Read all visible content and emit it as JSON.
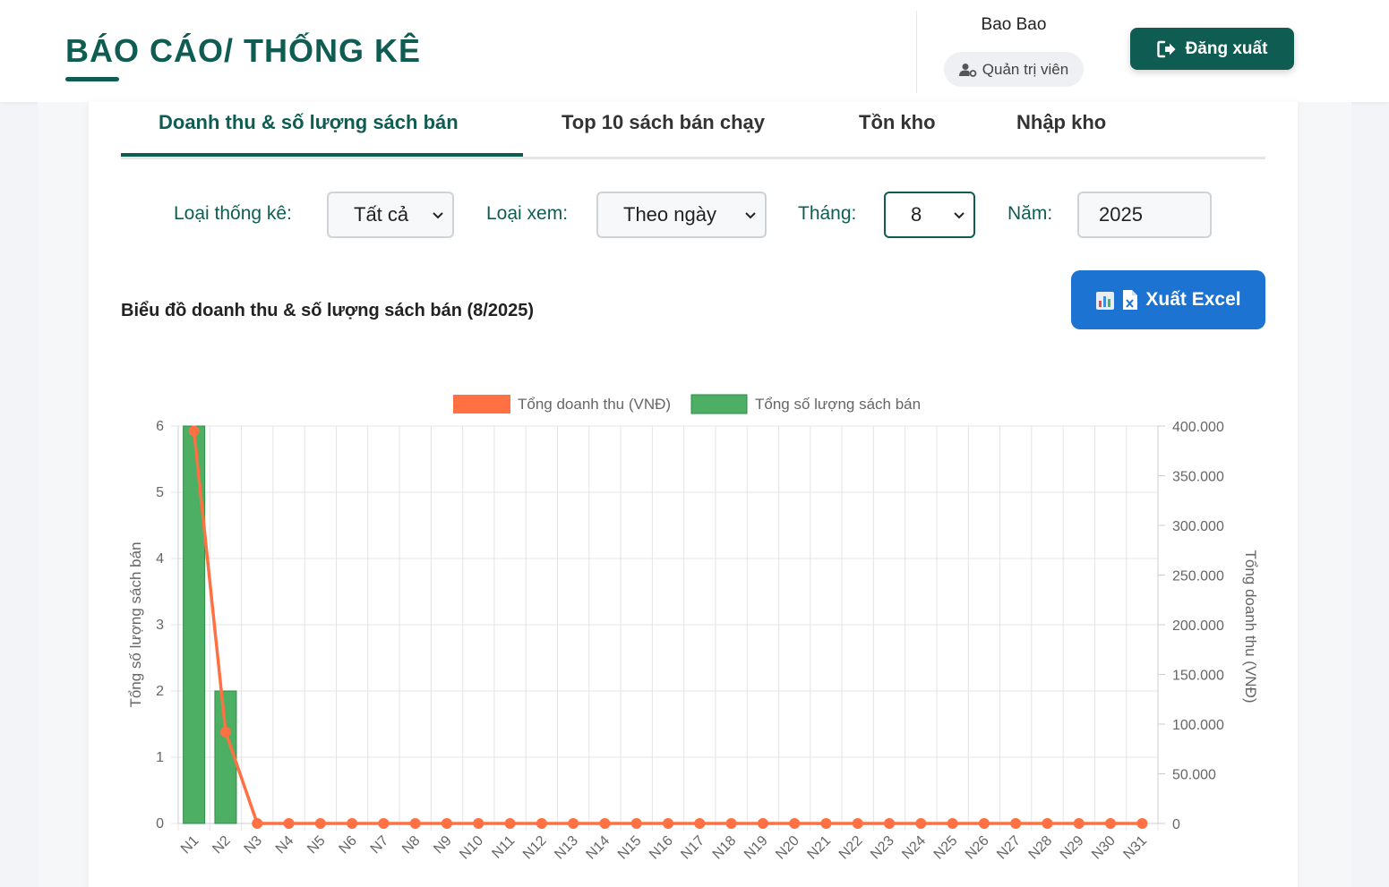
{
  "header": {
    "title": "BÁO CÁO/ THỐNG KÊ",
    "user_name": "Bao Bao",
    "role": "Quản trị viên",
    "logout_label": "Đăng xuất"
  },
  "tabs": [
    {
      "label": "Doanh thu & số lượng sách bán",
      "active": true
    },
    {
      "label": "Top 10 sách bán chạy",
      "active": false
    },
    {
      "label": "Tồn kho",
      "active": false
    },
    {
      "label": "Nhập kho",
      "active": false
    }
  ],
  "filters": {
    "stat_type_label": "Loại thống kê:",
    "stat_type_value": "Tất cả",
    "view_type_label": "Loại xem:",
    "view_type_value": "Theo ngày",
    "month_label": "Tháng:",
    "month_value": "8",
    "year_label": "Năm:",
    "year_value": "2025"
  },
  "chart_section": {
    "heading": "Biểu đồ doanh thu & số lượng sách bán (8/2025)",
    "export_label": "Xuất Excel"
  },
  "colors": {
    "brand": "#0f5d52",
    "revenue_line": "#ff7043",
    "quantity_bar": "#4caf63",
    "export_button": "#1d73d1"
  },
  "chart_data": {
    "type": "bar",
    "categories": [
      "N1",
      "N2",
      "N3",
      "N4",
      "N5",
      "N6",
      "N7",
      "N8",
      "N9",
      "N10",
      "N11",
      "N12",
      "N13",
      "N14",
      "N15",
      "N16",
      "N17",
      "N18",
      "N19",
      "N20",
      "N21",
      "N22",
      "N23",
      "N24",
      "N25",
      "N26",
      "N27",
      "N28",
      "N29",
      "N30",
      "N31"
    ],
    "series": [
      {
        "name": "Tổng doanh thu (VNĐ)",
        "type": "line",
        "axis": "right",
        "values": [
          395000,
          92000,
          0,
          0,
          0,
          0,
          0,
          0,
          0,
          0,
          0,
          0,
          0,
          0,
          0,
          0,
          0,
          0,
          0,
          0,
          0,
          0,
          0,
          0,
          0,
          0,
          0,
          0,
          0,
          0,
          0
        ]
      },
      {
        "name": "Tổng số lượng sách bán",
        "type": "bar",
        "axis": "left",
        "values": [
          6,
          2,
          0,
          0,
          0,
          0,
          0,
          0,
          0,
          0,
          0,
          0,
          0,
          0,
          0,
          0,
          0,
          0,
          0,
          0,
          0,
          0,
          0,
          0,
          0,
          0,
          0,
          0,
          0,
          0,
          0
        ]
      }
    ],
    "ylabel_left": "Tổng số lượng sách bán",
    "ylabel_right": "Tổng doanh thu (VNĐ)",
    "ylim_left": [
      0,
      6
    ],
    "ylim_right": [
      0,
      400000
    ],
    "yticks_left": [
      "0",
      "1",
      "2",
      "3",
      "4",
      "5",
      "6"
    ],
    "yticks_right": [
      "0",
      "50.000",
      "100.000",
      "150.000",
      "200.000",
      "250.000",
      "300.000",
      "350.000",
      "400.000"
    ],
    "legend_position": "top",
    "grid": true
  }
}
